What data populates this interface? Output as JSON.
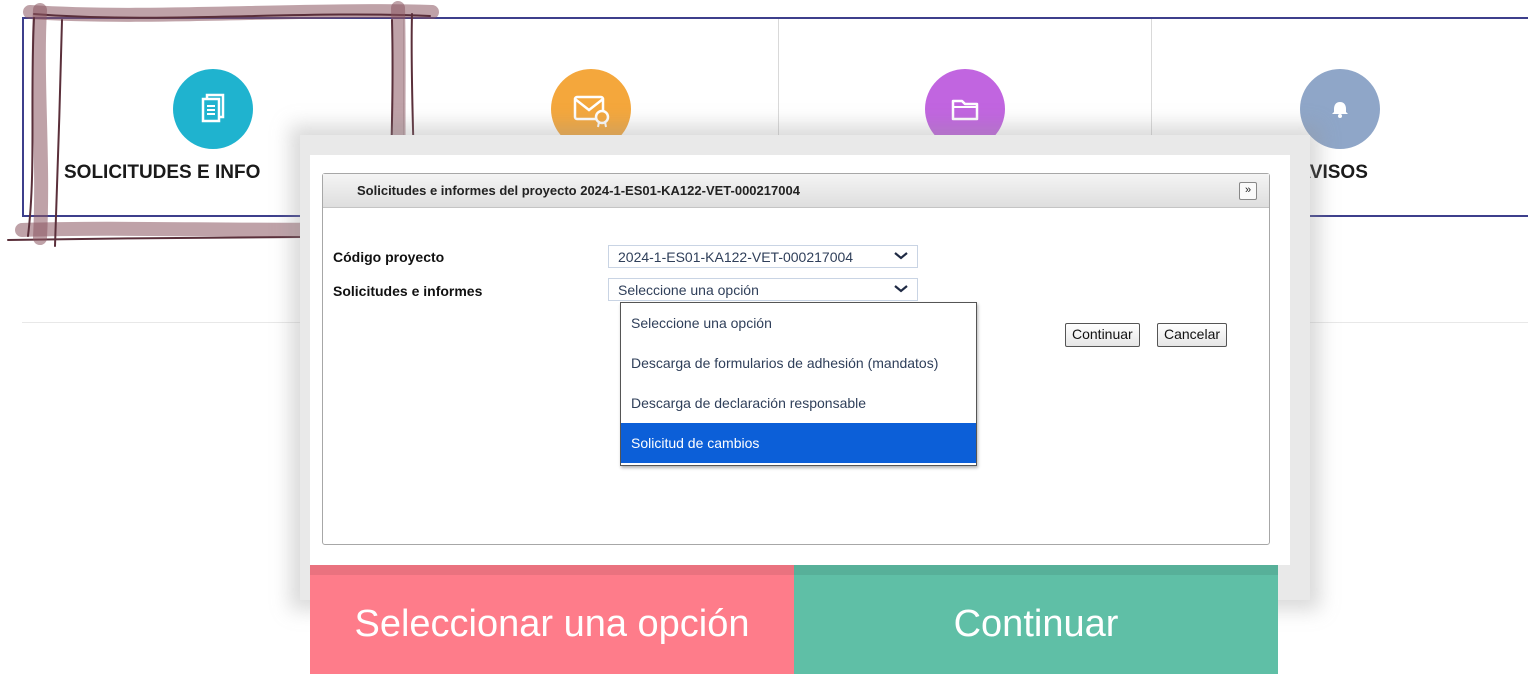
{
  "tiles": [
    {
      "label": "SOLICITUDES E INFO",
      "icon": "documents-icon",
      "color": "#1fb3cf"
    },
    {
      "label": "",
      "icon": "certified-mail-icon",
      "color": "#f4a73c"
    },
    {
      "label": "",
      "icon": "folder-icon",
      "color": "#c165e0"
    },
    {
      "label": "AVISOS",
      "icon": "bell-icon",
      "color": "#8fa6c8"
    }
  ],
  "modal": {
    "title": "Solicitudes e informes del proyecto 2024-1-ES01-KA122-VET-000217004",
    "close_symbol": "»",
    "project_code_label": "Código proyecto",
    "project_code_value": "2024-1-ES01-KA122-VET-000217004",
    "requests_label": "Solicitudes e informes",
    "requests_value": "Seleccione una opción",
    "dropdown_options": [
      "Seleccione una opción",
      "Descarga de formularios de adhesión (mandatos)",
      "Descarga de declaración responsable",
      "Solicitud de cambios"
    ],
    "selected_option_index": 3,
    "continue_label": "Continuar",
    "cancel_label": "Cancelar"
  },
  "cta": {
    "left_label": "Seleccionar una opción",
    "right_label": "Continuar",
    "left_color": "#fe7c8a",
    "right_color": "#5fbfa6"
  }
}
